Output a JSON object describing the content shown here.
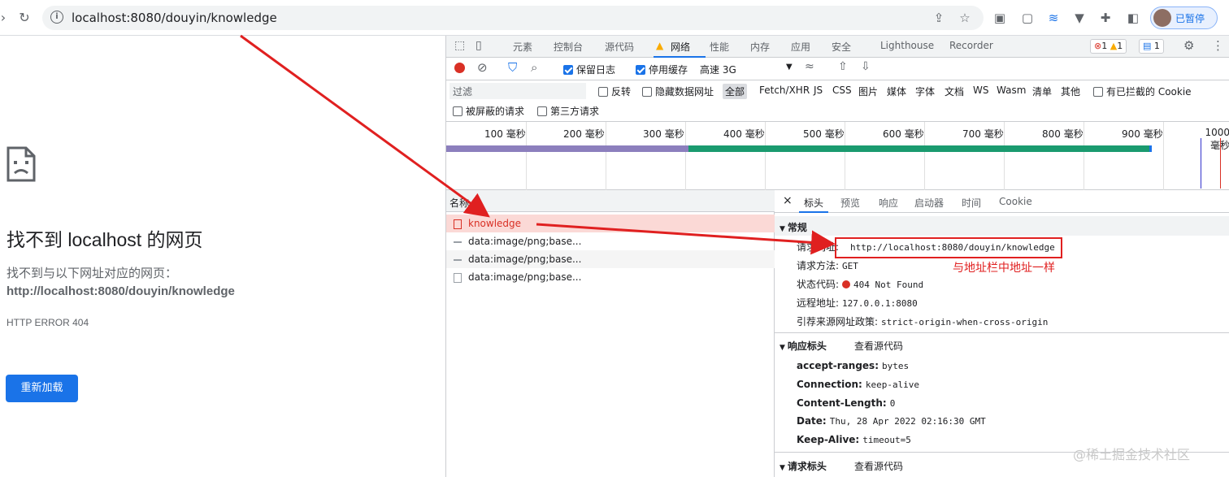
{
  "browser": {
    "url": "localhost:8080/douyin/knowledge",
    "profile_label": "已暂停"
  },
  "error_page": {
    "title": "找不到 localhost 的网页",
    "subtitle": "找不到与以下网址对应的网页：",
    "url": "http://localhost:8080/douyin/knowledge",
    "code": "HTTP ERROR 404",
    "reload_label": "重新加载"
  },
  "devtools": {
    "tabs": [
      "元素",
      "控制台",
      "源代码",
      "网络",
      "性能",
      "内存",
      "应用",
      "安全",
      "Lighthouse",
      "Recorder"
    ],
    "errors_count": "1",
    "warnings_count": "1",
    "issues_count": "1",
    "toolbar": {
      "preserve_log": "保留日志",
      "disable_cache": "停用缓存",
      "throttle": "高速 3G"
    },
    "filter": {
      "placeholder": "过滤",
      "invert": "反转",
      "hide_data_urls": "隐藏数据网址",
      "types": [
        "全部",
        "Fetch/XHR",
        "JS",
        "CSS",
        "图片",
        "媒体",
        "字体",
        "文档",
        "WS",
        "Wasm",
        "清单",
        "其他"
      ],
      "blocked_cookies": "有已拦截的 Cookie",
      "blocked_requests": "被屏蔽的请求",
      "third_party": "第三方请求"
    },
    "timeline_labels": [
      "100 毫秒",
      "200 毫秒",
      "300 毫秒",
      "400 毫秒",
      "500 毫秒",
      "600 毫秒",
      "700 毫秒",
      "800 毫秒",
      "900 毫秒",
      "1000 毫秒"
    ],
    "requests_header": "名称",
    "requests": [
      "knowledge",
      "data:image/png;base...",
      "data:image/png;base...",
      "data:image/png;base..."
    ],
    "detail_tabs": [
      "标头",
      "预览",
      "响应",
      "启动器",
      "时间",
      "Cookie"
    ],
    "general": {
      "title": "常规",
      "request_url_key": "请求网址:",
      "request_url": "http://localhost:8080/douyin/knowledge",
      "method_key": "请求方法:",
      "method": "GET",
      "status_key": "状态代码:",
      "status": "404 Not Found",
      "remote_key": "远程地址:",
      "remote": "127.0.0.1:8080",
      "referrer_key": "引荐来源网址政策:",
      "referrer": "strict-origin-when-cross-origin"
    },
    "response_headers": {
      "title": "响应标头",
      "view_source": "查看源代码",
      "items": [
        {
          "k": "accept-ranges:",
          "v": "bytes"
        },
        {
          "k": "Connection:",
          "v": "keep-alive"
        },
        {
          "k": "Content-Length:",
          "v": "0"
        },
        {
          "k": "Date:",
          "v": "Thu, 28 Apr 2022 02:16:30 GMT"
        },
        {
          "k": "Keep-Alive:",
          "v": "timeout=5"
        }
      ]
    },
    "request_headers": {
      "title": "请求标头",
      "view_source": "查看源代码"
    }
  },
  "annotation": "与地址栏中地址一样",
  "watermark": "@稀土掘金技术社区",
  "colors": {
    "accent": "#1a73e8",
    "annotation_red": "#e02020",
    "error_red": "#d93025"
  }
}
